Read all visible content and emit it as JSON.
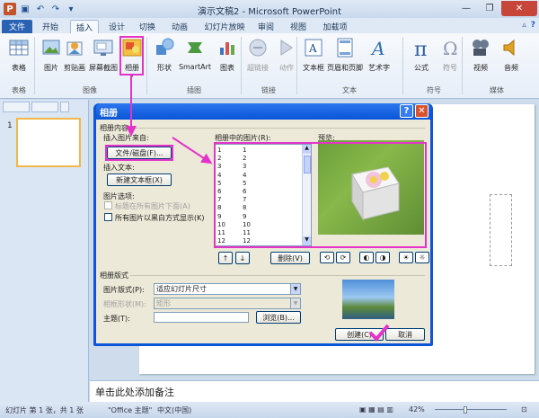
{
  "app": {
    "title": "演示文稿2 - Microsoft PowerPoint"
  },
  "tabs": [
    "文件",
    "开始",
    "插入",
    "设计",
    "切换",
    "动画",
    "幻灯片放映",
    "审阅",
    "视图",
    "加载项"
  ],
  "ribbon": {
    "groups": [
      "表格",
      "图像",
      "插图",
      "链接",
      "文本",
      "符号",
      "媒体"
    ],
    "buttons": {
      "table": "表格",
      "picture": "图片",
      "clipart": "剪贴画",
      "screenshot": "屏幕截图",
      "album": "相册",
      "shapes": "形状",
      "smartart": "SmartArt",
      "chart": "图表",
      "hyperlink": "超链接",
      "action": "动作",
      "textbox": "文本框",
      "header": "页眉和页脚",
      "wordart": "艺术字",
      "formula": "公式",
      "symbol": "符号",
      "video": "视频",
      "audio": "音频"
    }
  },
  "slide_panel": {
    "slide_number": "1"
  },
  "notes": {
    "placeholder": "单击此处添加备注"
  },
  "status": {
    "slide_info": "幻灯片 第 1 张，共 1 张",
    "theme": "\"Office 主题\"",
    "language": "中文(中国)",
    "zoom": "42%"
  },
  "dialog": {
    "title": "相册",
    "album_content": "相册内容",
    "insert_from": "插入图片来自:",
    "file_disk_btn": "文件/磁盘(F)...",
    "insert_text": "插入文本:",
    "new_textbox_btn": "新建文本框(X)",
    "picture_options": "图片选项:",
    "option_captions": "标题在所有图片下面(A)",
    "option_bw": "所有图片以黑白方式显示(K)",
    "pictures_in_album": "相册中的图片(R):",
    "preview": "预览:",
    "list_rows": [
      {
        "n": "1",
        "name": "1"
      },
      {
        "n": "2",
        "name": "2"
      },
      {
        "n": "3",
        "name": "3"
      },
      {
        "n": "4",
        "name": "4"
      },
      {
        "n": "5",
        "name": "5"
      },
      {
        "n": "6",
        "name": "6"
      },
      {
        "n": "7",
        "name": "7"
      },
      {
        "n": "8",
        "name": "8"
      },
      {
        "n": "9",
        "name": "9"
      },
      {
        "n": "10",
        "name": "10"
      },
      {
        "n": "11",
        "name": "11"
      },
      {
        "n": "12",
        "name": "12"
      }
    ],
    "delete_btn": "删除(V)",
    "album_layout": "相册版式",
    "picture_layout_label": "图片版式(P):",
    "picture_layout_value": "适应幻灯片尺寸",
    "frame_shape_label": "相框形状(M):",
    "frame_shape_value": "矩形",
    "theme_label": "主题(T):",
    "browse_btn": "浏览(B)...",
    "create_btn": "创建(C)",
    "cancel_btn": "取消"
  },
  "colors": {
    "highlight": "#e533c9",
    "dialog_title": "#0a55d8",
    "file_tab": "#2a62b4"
  }
}
